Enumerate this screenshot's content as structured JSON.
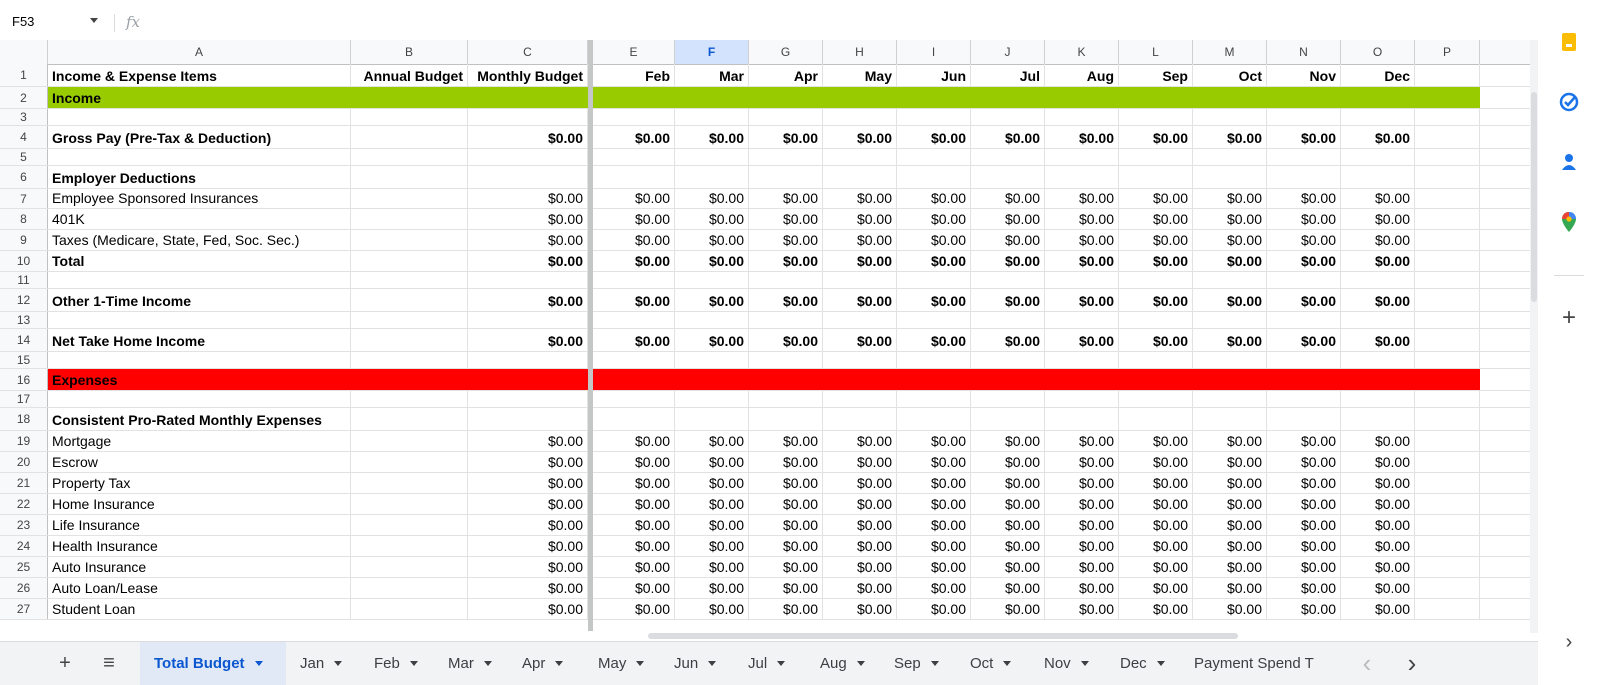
{
  "formula_bar": {
    "name_box": "F53",
    "fx_label": "fx",
    "formula": ""
  },
  "columns": [
    {
      "letter": "A",
      "w": 303
    },
    {
      "letter": "B",
      "w": 117
    },
    {
      "letter": "C",
      "w": 120
    },
    {
      "letter": "E",
      "w": 82
    },
    {
      "letter": "F",
      "w": 74,
      "selected": true
    },
    {
      "letter": "G",
      "w": 74
    },
    {
      "letter": "H",
      "w": 74
    },
    {
      "letter": "I",
      "w": 74
    },
    {
      "letter": "J",
      "w": 74
    },
    {
      "letter": "K",
      "w": 74
    },
    {
      "letter": "L",
      "w": 74
    },
    {
      "letter": "M",
      "w": 74
    },
    {
      "letter": "N",
      "w": 74
    },
    {
      "letter": "O",
      "w": 74
    },
    {
      "letter": "P",
      "w": 65
    }
  ],
  "rows": [
    {
      "n": "1",
      "h": 23,
      "style": "bold",
      "cells": [
        "Income & Expense Items",
        "Annual Budget",
        "Monthly Budget",
        "Feb",
        "Mar",
        "Apr",
        "May",
        "Jun",
        "Jul",
        "Aug",
        "Sep",
        "Oct",
        "Nov",
        "Dec",
        ""
      ]
    },
    {
      "n": "2",
      "h": 22,
      "style": "band-income bold",
      "cells": [
        "Income",
        "",
        "",
        "",
        "",
        "",
        "",
        "",
        "",
        "",
        "",
        "",
        "",
        "",
        ""
      ]
    },
    {
      "n": "3",
      "h": 17,
      "cells": [
        "",
        "",
        "",
        "",
        "",
        "",
        "",
        "",
        "",
        "",
        "",
        "",
        "",
        "",
        ""
      ]
    },
    {
      "n": "4",
      "h": 23,
      "style": "bold",
      "cells": [
        "Gross Pay (Pre-Tax & Deduction)",
        "",
        "$0.00",
        "$0.00",
        "$0.00",
        "$0.00",
        "$0.00",
        "$0.00",
        "$0.00",
        "$0.00",
        "$0.00",
        "$0.00",
        "$0.00",
        "$0.00",
        ""
      ]
    },
    {
      "n": "5",
      "h": 17,
      "cells": [
        "",
        "",
        "",
        "",
        "",
        "",
        "",
        "",
        "",
        "",
        "",
        "",
        "",
        "",
        ""
      ]
    },
    {
      "n": "6",
      "h": 23,
      "style": "bold",
      "cells": [
        "Employer Deductions",
        "",
        "",
        "",
        "",
        "",
        "",
        "",
        "",
        "",
        "",
        "",
        "",
        "",
        ""
      ]
    },
    {
      "n": "7",
      "h": 20,
      "cells": [
        "Employee Sponsored Insurances",
        "",
        "$0.00",
        "$0.00",
        "$0.00",
        "$0.00",
        "$0.00",
        "$0.00",
        "$0.00",
        "$0.00",
        "$0.00",
        "$0.00",
        "$0.00",
        "$0.00",
        ""
      ]
    },
    {
      "n": "8",
      "h": 21,
      "cells": [
        "401K",
        "",
        "$0.00",
        "$0.00",
        "$0.00",
        "$0.00",
        "$0.00",
        "$0.00",
        "$0.00",
        "$0.00",
        "$0.00",
        "$0.00",
        "$0.00",
        "$0.00",
        ""
      ]
    },
    {
      "n": "9",
      "h": 21,
      "cells": [
        "Taxes (Medicare, State, Fed, Soc. Sec.)",
        "",
        "$0.00",
        "$0.00",
        "$0.00",
        "$0.00",
        "$0.00",
        "$0.00",
        "$0.00",
        "$0.00",
        "$0.00",
        "$0.00",
        "$0.00",
        "$0.00",
        ""
      ]
    },
    {
      "n": "10",
      "h": 21,
      "style": "bold",
      "cells": [
        "Total",
        "",
        "$0.00",
        "$0.00",
        "$0.00",
        "$0.00",
        "$0.00",
        "$0.00",
        "$0.00",
        "$0.00",
        "$0.00",
        "$0.00",
        "$0.00",
        "$0.00",
        ""
      ]
    },
    {
      "n": "11",
      "h": 17,
      "cells": [
        "",
        "",
        "",
        "",
        "",
        "",
        "",
        "",
        "",
        "",
        "",
        "",
        "",
        "",
        ""
      ]
    },
    {
      "n": "12",
      "h": 23,
      "style": "bold",
      "cells": [
        "Other 1-Time Income",
        "",
        "$0.00",
        "$0.00",
        "$0.00",
        "$0.00",
        "$0.00",
        "$0.00",
        "$0.00",
        "$0.00",
        "$0.00",
        "$0.00",
        "$0.00",
        "$0.00",
        ""
      ]
    },
    {
      "n": "13",
      "h": 17,
      "cells": [
        "",
        "",
        "",
        "",
        "",
        "",
        "",
        "",
        "",
        "",
        "",
        "",
        "",
        "",
        ""
      ]
    },
    {
      "n": "14",
      "h": 23,
      "style": "bold",
      "cells": [
        "Net Take Home Income",
        "",
        "$0.00",
        "$0.00",
        "$0.00",
        "$0.00",
        "$0.00",
        "$0.00",
        "$0.00",
        "$0.00",
        "$0.00",
        "$0.00",
        "$0.00",
        "$0.00",
        ""
      ]
    },
    {
      "n": "15",
      "h": 17,
      "cells": [
        "",
        "",
        "",
        "",
        "",
        "",
        "",
        "",
        "",
        "",
        "",
        "",
        "",
        "",
        ""
      ]
    },
    {
      "n": "16",
      "h": 22,
      "style": "band-expenses bold",
      "cells": [
        "Expenses",
        "",
        "",
        "",
        "",
        "",
        "",
        "",
        "",
        "",
        "",
        "",
        "",
        "",
        ""
      ]
    },
    {
      "n": "17",
      "h": 17,
      "cells": [
        "",
        "",
        "",
        "",
        "",
        "",
        "",
        "",
        "",
        "",
        "",
        "",
        "",
        "",
        ""
      ]
    },
    {
      "n": "18",
      "h": 23,
      "style": "bold",
      "cells": [
        "Consistent Pro-Rated Monthly Expenses",
        "",
        "",
        "",
        "",
        "",
        "",
        "",
        "",
        "",
        "",
        "",
        "",
        "",
        ""
      ]
    },
    {
      "n": "19",
      "h": 21,
      "cells": [
        "Mortgage",
        "",
        "$0.00",
        "$0.00",
        "$0.00",
        "$0.00",
        "$0.00",
        "$0.00",
        "$0.00",
        "$0.00",
        "$0.00",
        "$0.00",
        "$0.00",
        "$0.00",
        ""
      ]
    },
    {
      "n": "20",
      "h": 21,
      "cells": [
        "Escrow",
        "",
        "$0.00",
        "$0.00",
        "$0.00",
        "$0.00",
        "$0.00",
        "$0.00",
        "$0.00",
        "$0.00",
        "$0.00",
        "$0.00",
        "$0.00",
        "$0.00",
        ""
      ]
    },
    {
      "n": "21",
      "h": 21,
      "cells": [
        "Property Tax",
        "",
        "$0.00",
        "$0.00",
        "$0.00",
        "$0.00",
        "$0.00",
        "$0.00",
        "$0.00",
        "$0.00",
        "$0.00",
        "$0.00",
        "$0.00",
        "$0.00",
        ""
      ]
    },
    {
      "n": "22",
      "h": 21,
      "cells": [
        "Home Insurance",
        "",
        "$0.00",
        "$0.00",
        "$0.00",
        "$0.00",
        "$0.00",
        "$0.00",
        "$0.00",
        "$0.00",
        "$0.00",
        "$0.00",
        "$0.00",
        "$0.00",
        ""
      ]
    },
    {
      "n": "23",
      "h": 21,
      "cells": [
        "Life Insurance",
        "",
        "$0.00",
        "$0.00",
        "$0.00",
        "$0.00",
        "$0.00",
        "$0.00",
        "$0.00",
        "$0.00",
        "$0.00",
        "$0.00",
        "$0.00",
        "$0.00",
        ""
      ]
    },
    {
      "n": "24",
      "h": 21,
      "cells": [
        "Health Insurance",
        "",
        "$0.00",
        "$0.00",
        "$0.00",
        "$0.00",
        "$0.00",
        "$0.00",
        "$0.00",
        "$0.00",
        "$0.00",
        "$0.00",
        "$0.00",
        "$0.00",
        ""
      ]
    },
    {
      "n": "25",
      "h": 21,
      "cells": [
        "Auto Insurance",
        "",
        "$0.00",
        "$0.00",
        "$0.00",
        "$0.00",
        "$0.00",
        "$0.00",
        "$0.00",
        "$0.00",
        "$0.00",
        "$0.00",
        "$0.00",
        "$0.00",
        ""
      ]
    },
    {
      "n": "26",
      "h": 21,
      "cells": [
        "Auto Loan/Lease",
        "",
        "$0.00",
        "$0.00",
        "$0.00",
        "$0.00",
        "$0.00",
        "$0.00",
        "$0.00",
        "$0.00",
        "$0.00",
        "$0.00",
        "$0.00",
        "$0.00",
        ""
      ]
    },
    {
      "n": "27",
      "h": 21,
      "cells": [
        "Student Loan",
        "",
        "$0.00",
        "$0.00",
        "$0.00",
        "$0.00",
        "$0.00",
        "$0.00",
        "$0.00",
        "$0.00",
        "$0.00",
        "$0.00",
        "$0.00",
        "$0.00",
        ""
      ]
    }
  ],
  "sheet_tabs": [
    {
      "label": "Total Budget",
      "active": true
    },
    {
      "label": "Jan"
    },
    {
      "label": "Feb"
    },
    {
      "label": "Mar"
    },
    {
      "label": "Apr"
    },
    {
      "label": "May"
    },
    {
      "label": "Jun"
    },
    {
      "label": "Jul"
    },
    {
      "label": "Aug"
    },
    {
      "label": "Sep"
    },
    {
      "label": "Oct"
    },
    {
      "label": "Nov"
    },
    {
      "label": "Dec"
    },
    {
      "label": "Payment Spend T",
      "nocaret": true
    }
  ],
  "tabbar_buttons": {
    "add_sheet": "+",
    "all_sheets": "≡",
    "scroll_left": "‹",
    "scroll_right": "›"
  },
  "side_panel": {
    "icons": [
      "keep-icon",
      "tasks-icon",
      "contacts-icon",
      "maps-icon"
    ],
    "add": "+",
    "expand": "›"
  },
  "colors": {
    "income_band": "#99cc00",
    "expenses_band": "#ff0000",
    "active_tab": "#0b57d0"
  }
}
